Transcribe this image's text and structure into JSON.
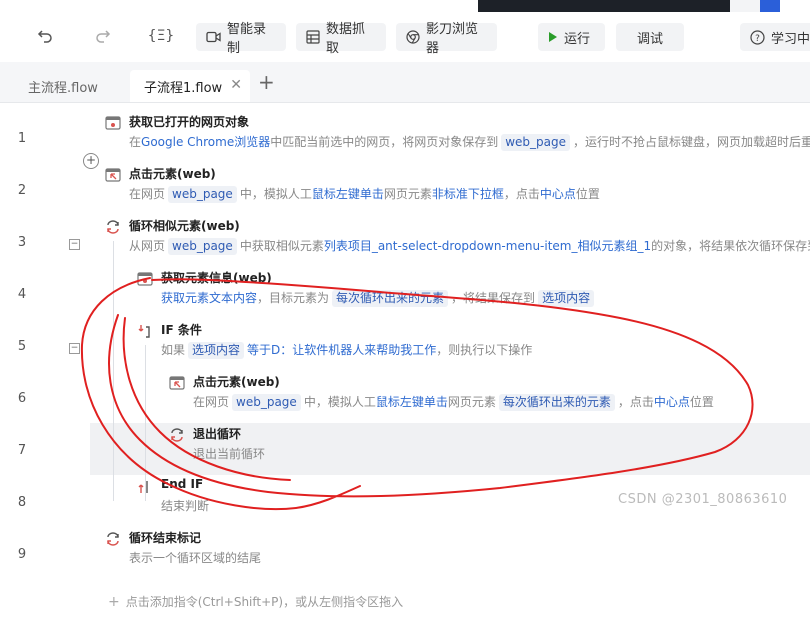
{
  "toolbar": {
    "record_label": "智能录制",
    "scrape_label": "数据抓取",
    "browser_label": "影刀浏览器",
    "run_label": "运行",
    "debug_label": "调试",
    "learn_label": "学习中"
  },
  "tabs": [
    {
      "label": "主流程.flow",
      "active": false
    },
    {
      "label": "子流程1.flow",
      "active": true
    }
  ],
  "rows": [
    {
      "line": "1",
      "title": "获取已打开的网页对象",
      "desc": [
        "在",
        {
          "link": "Google Chrome浏览器"
        },
        "中匹配当前选中的网页，将网页对象保存到",
        {
          "tag": "web_page"
        },
        "，运行时不抢占鼠标键盘，网页加载超时后重"
      ]
    },
    {
      "line": "2",
      "title": "点击元素(web)",
      "desc": [
        "在网页",
        {
          "tag": "web_page"
        },
        "中，模拟人工",
        {
          "link": "鼠标左键单击"
        },
        "网页元素",
        {
          "link": "非标准下拉框"
        },
        "，点击",
        {
          "link": "中心点"
        },
        "位置"
      ]
    },
    {
      "line": "3",
      "title": "循环相似元素(web)",
      "desc": [
        "从网页",
        {
          "tag": "web_page"
        },
        "中获取相似元素",
        {
          "link": "列表项目_ant-select-dropdown-menu-item_相似元素组_1"
        },
        "的对象，将结果依次循环保存到"
      ]
    },
    {
      "line": "4",
      "title": "获取元素信息(web)",
      "desc": [
        {
          "link": "获取元素文本内容"
        },
        "，目标元素为",
        {
          "tag": "每次循环出来的元素"
        },
        "，将结果保存到",
        {
          "tag": "选项内容"
        }
      ]
    },
    {
      "line": "5",
      "title": "IF 条件",
      "desc": [
        "如果",
        {
          "tag": "选项内容"
        },
        {
          "link": "等于D：让软件机器人来帮助我工作"
        },
        "，则执行以下操作"
      ]
    },
    {
      "line": "6",
      "title": "点击元素(web)",
      "desc": [
        "在网页",
        {
          "tag": "web_page"
        },
        "中，模拟人工",
        {
          "link": "鼠标左键单击"
        },
        "网页元素",
        {
          "tag": "每次循环出来的元素"
        },
        "，点击",
        {
          "link": "中心点"
        },
        "位置"
      ]
    },
    {
      "line": "7",
      "title": "退出循环",
      "desc": [
        "退出当前循环"
      ]
    },
    {
      "line": "8",
      "title": "End IF",
      "desc": [
        "结束判断"
      ]
    },
    {
      "line": "9",
      "title": "循环结束标记",
      "desc": [
        "表示一个循环区域的结尾"
      ]
    }
  ],
  "add_hint": "点击添加指令(Ctrl+Shift+P)，或从左侧指令区拖入",
  "watermark": "CSDN @2301_80863610",
  "colors": {
    "accent": "#2f6bd0",
    "annotation": "#e02020",
    "highlight_row": "#f0f1f3"
  }
}
